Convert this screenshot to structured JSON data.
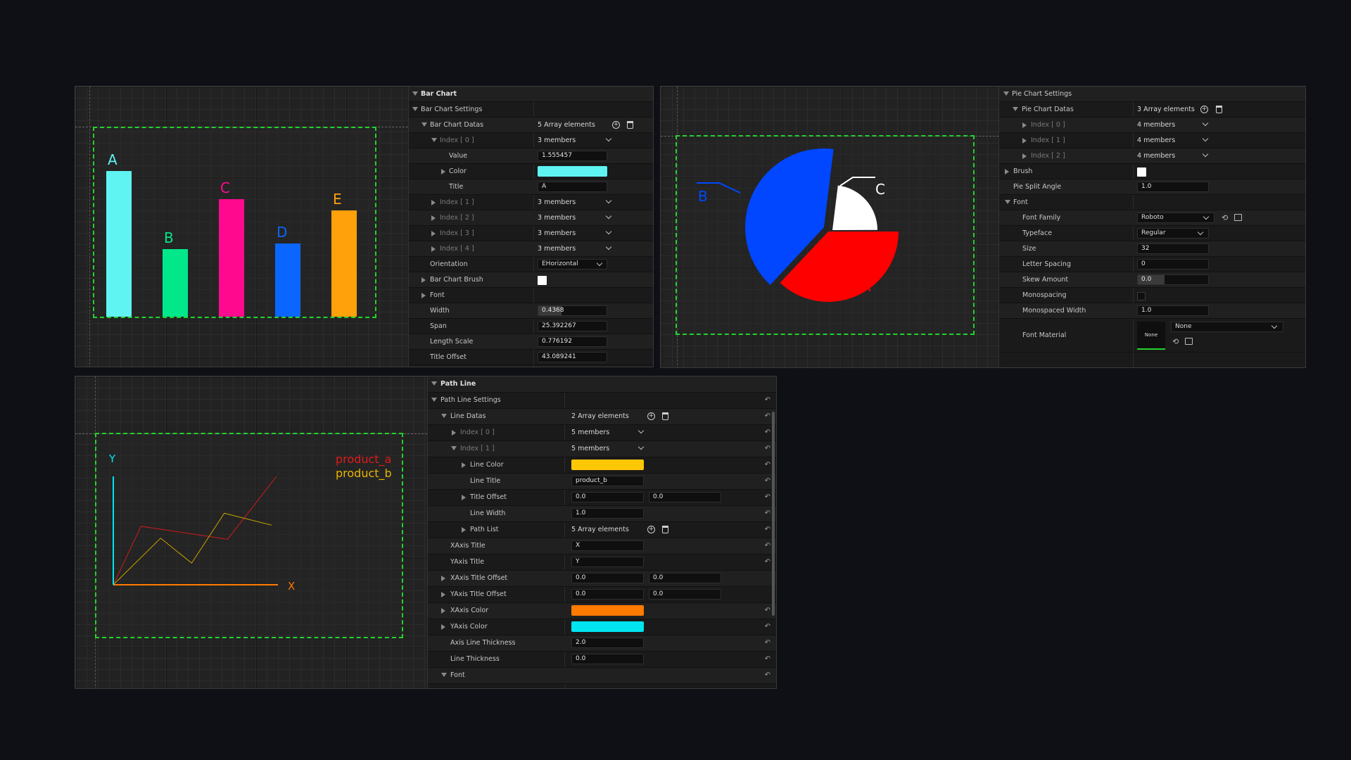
{
  "bar_panel": {
    "header": "Bar Chart",
    "settings_label": "Bar Chart Settings",
    "datas_label": "Bar Chart Datas",
    "datas_count": "5 Array elements",
    "index0_label": "Index [ 0 ]",
    "index0_value": "3 members",
    "value_label": "Value",
    "value_value": "1.555457",
    "color_label": "Color",
    "color_value": "#5ff3f2",
    "title_label": "Title",
    "title_value": "A",
    "indexes": [
      {
        "label": "Index [ 1 ]",
        "value": "3 members"
      },
      {
        "label": "Index [ 2 ]",
        "value": "3 members"
      },
      {
        "label": "Index [ 3 ]",
        "value": "3 members"
      },
      {
        "label": "Index [ 4 ]",
        "value": "3 members"
      }
    ],
    "orientation_label": "Orientation",
    "orientation_value": "EHorizontal",
    "brush_label": "Bar Chart Brush",
    "font_label": "Font",
    "width_label": "Width",
    "width_value": "0.4368",
    "span_label": "Span",
    "span_value": "25.392267",
    "length_label": "Length Scale",
    "length_value": "0.776192",
    "title_offset_label": "Title Offset",
    "title_offset_value": "43.089241"
  },
  "bar_chart_data": {
    "type": "bar",
    "categories": [
      "A",
      "B",
      "C",
      "D",
      "E"
    ],
    "values": [
      1.555,
      0.72,
      1.25,
      0.78,
      1.13
    ],
    "colors": [
      "#5ff3f2",
      "#00e88a",
      "#ff0a8f",
      "#0a66ff",
      "#ffa10a"
    ],
    "ylim": [
      0,
      2.0
    ]
  },
  "pie_panel": {
    "settings_label": "Pie Chart Settings",
    "datas_label": "Pie Chart Datas",
    "datas_count": "3 Array elements",
    "indexes": [
      {
        "label": "Index [ 0 ]",
        "value": "4 members"
      },
      {
        "label": "Index [ 1 ]",
        "value": "4 members"
      },
      {
        "label": "Index [ 2 ]",
        "value": "4 members"
      }
    ],
    "brush_label": "Brush",
    "split_label": "Pie Split Angle",
    "split_value": "1.0",
    "font_label": "Font",
    "family_label": "Font Family",
    "family_value": "Roboto",
    "typeface_label": "Typeface",
    "typeface_value": "Regular",
    "size_label": "Size",
    "size_value": "32",
    "letter_label": "Letter Spacing",
    "letter_value": "0",
    "skew_label": "Skew Amount",
    "skew_value": "0.0",
    "mono_label": "Monospacing",
    "monow_label": "Monospaced Width",
    "monow_value": "1.0",
    "material_label": "Font Material",
    "material_thumb": "None",
    "material_value": "None"
  },
  "pie_chart_data": {
    "type": "pie",
    "slices": [
      {
        "label": "A",
        "value": 37,
        "color": "#ff0000"
      },
      {
        "label": "B",
        "value": 40,
        "color": "#0047ff"
      },
      {
        "label": "C",
        "value": 23,
        "color": "#ffffff"
      }
    ]
  },
  "line_panel": {
    "header": "Path Line",
    "settings_label": "Path Line Settings",
    "datas_label": "Line Datas",
    "datas_count": "2 Array elements",
    "index0_label": "Index [ 0 ]",
    "index0_value": "5 members",
    "index1_label": "Index [ 1 ]",
    "index1_value": "5 members",
    "line_color_label": "Line Color",
    "line_color_value": "#ffc807",
    "line_title_label": "Line Title",
    "line_title_value": "product_b",
    "title_offset_label": "Title Offset",
    "title_offset_x": "0.0",
    "title_offset_y": "0.0",
    "line_width_label": "Line Width",
    "line_width_value": "1.0",
    "path_list_label": "Path List",
    "path_list_count": "5 Array elements",
    "xaxis_title_label": "XAxis Title",
    "xaxis_title_value": "X",
    "yaxis_title_label": "YAxis Title",
    "yaxis_title_value": "Y",
    "xaxis_offset_label": "XAxis Title Offset",
    "xaxis_offset_x": "0.0",
    "xaxis_offset_y": "0.0",
    "yaxis_offset_label": "YAxis Title Offset",
    "yaxis_offset_x": "0.0",
    "yaxis_offset_y": "0.0",
    "xaxis_color_label": "XAxis Color",
    "xaxis_color_value": "#ff7a00",
    "yaxis_color_label": "YAxis Color",
    "yaxis_color_value": "#00e5f0",
    "axis_thick_label": "Axis Line Thickness",
    "axis_thick_value": "2.0",
    "line_thick_label": "Line Thickness",
    "line_thick_value": "0.0",
    "font_label": "Font"
  },
  "line_chart_data": {
    "type": "line",
    "xlabel": "X",
    "ylabel": "Y",
    "series": [
      {
        "name": "product_a",
        "color": "#d01b1b",
        "x": [
          0,
          0.17,
          0.7,
          1.0
        ],
        "y": [
          0,
          0.54,
          0.42,
          1.0
        ]
      },
      {
        "name": "product_b",
        "color": "#c8a200",
        "x": [
          0,
          0.29,
          0.48,
          0.68,
          0.97
        ],
        "y": [
          0,
          0.43,
          0.2,
          0.66,
          0.55
        ]
      }
    ]
  }
}
